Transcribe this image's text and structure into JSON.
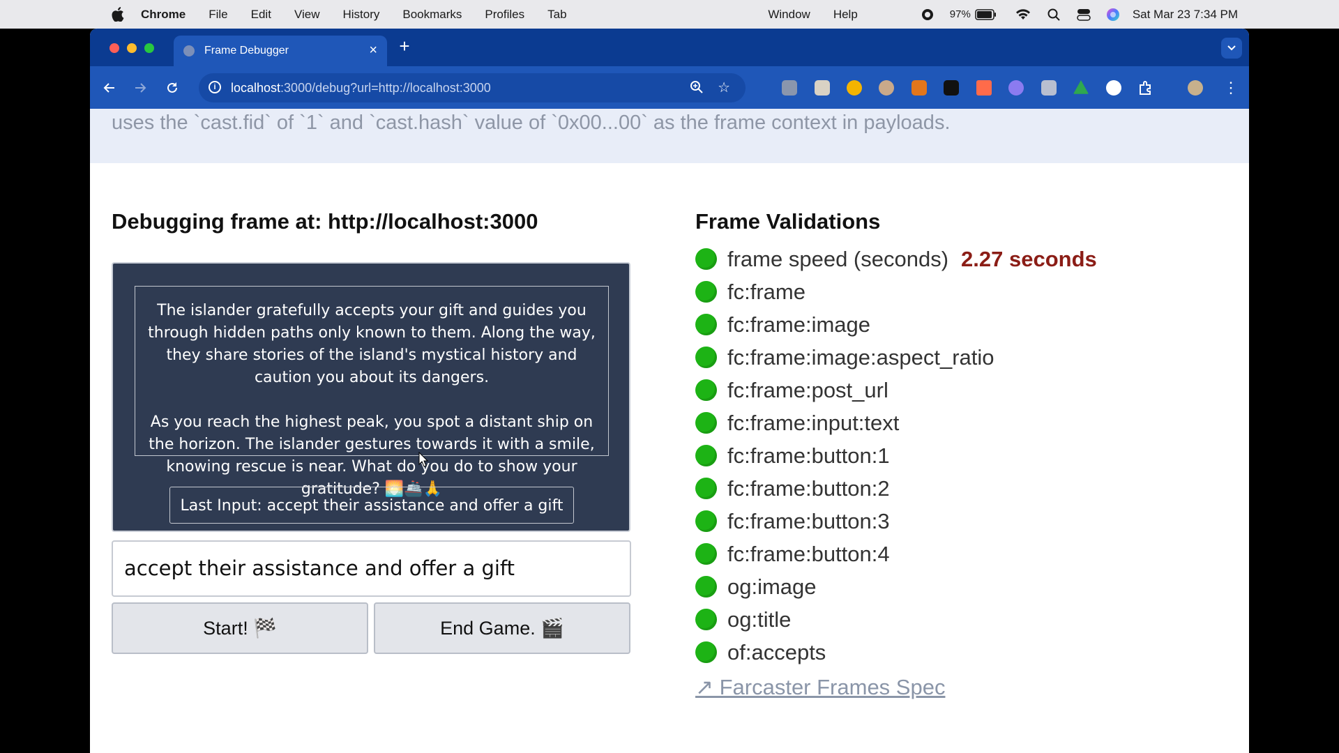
{
  "menubar": {
    "app_name": "Chrome",
    "menus": [
      "File",
      "Edit",
      "View",
      "History",
      "Bookmarks",
      "Profiles",
      "Tab"
    ],
    "right_menus": [
      "Window",
      "Help"
    ],
    "battery": "97%",
    "datetime": "Sat Mar 23  7:34 PM"
  },
  "browser": {
    "tab_title": "Frame Debugger",
    "url_host": "localhost",
    "url_rest": ":3000/debug?url=http://localhost:3000",
    "extension_icons": [
      "ublock-icon",
      "notes-icon",
      "edge-like-icon",
      "eyes-icon",
      "metamask-icon",
      "dark-app-icon",
      "pencil-icon",
      "cloud-icon",
      "ext-h-icon",
      "drive-icon",
      "s-icon",
      "puzzle-icon"
    ]
  },
  "page": {
    "banner_text": "uses the `cast.fid` of `1` and `cast.hash` value of `0x00...00` as the frame context in payloads.",
    "debug_heading": "Debugging frame at: http://localhost:3000",
    "frame": {
      "story_p1": "The islander gratefully accepts your gift and guides you through hidden paths only known to them. Along the way, they share stories of the island's mystical history and caution you about its dangers.",
      "story_p2": "As you reach the highest peak, you spot a distant ship on the horizon. The islander gestures towards it with a smile, knowing rescue is near.  What do you do to show your gratitude? 🌅🚢🙏",
      "last_input": "Last Input: accept their assistance and offer a gift"
    },
    "input_value": "accept their assistance and offer a gift",
    "buttons": [
      {
        "label": "Start! 🏁"
      },
      {
        "label": "End Game. 🎬"
      }
    ],
    "validations_title": "Frame Validations",
    "speed_label": "frame speed (seconds)",
    "speed_value": "2.27 seconds",
    "validations": [
      "fc:frame",
      "fc:frame:image",
      "fc:frame:image:aspect_ratio",
      "fc:frame:post_url",
      "fc:frame:input:text",
      "fc:frame:button:1",
      "fc:frame:button:2",
      "fc:frame:button:3",
      "fc:frame:button:4",
      "og:image",
      "og:title",
      "of:accepts"
    ],
    "spec_link": "↗ Farcaster Frames Spec",
    "status_color": "#1db315"
  }
}
